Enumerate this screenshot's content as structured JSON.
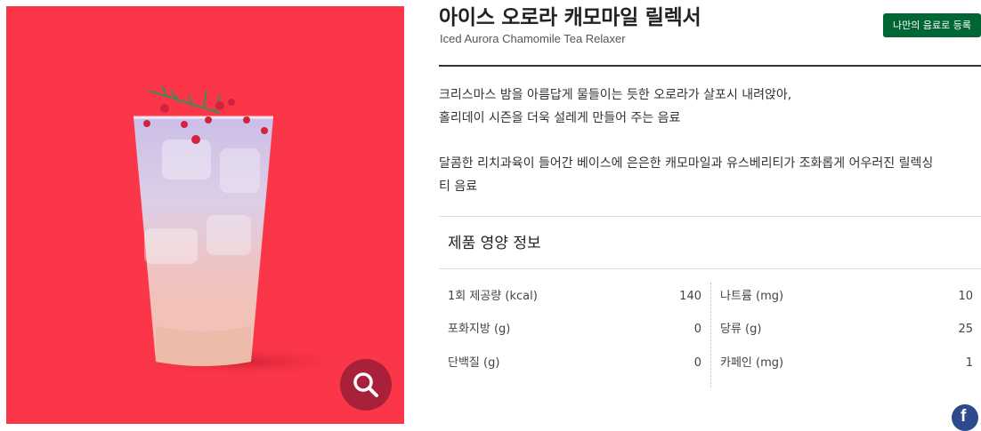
{
  "product": {
    "title_ko": "아이스 오로라 캐모마일 릴렉서",
    "title_en": "Iced Aurora Chamomile Tea Relaxer",
    "register_button": "나만의 음료로 등록",
    "description": [
      "크리스마스 밤을 아름답게 물들이는 듯한 오로라가 살포시 내려앉아,",
      "홀리데이 시즌을 더욱 설레게 만들어 주는 음료",
      "달콤한 리치과육이 들어간 베이스에 은은한 캐모마일과 유스베리티가 조화롭게 어우러진 릴렉싱",
      "티 음료"
    ]
  },
  "nutrition": {
    "title": "제품 영양 정보",
    "left": [
      {
        "label": "1회 제공량 (kcal)",
        "value": "140"
      },
      {
        "label": "포화지방 (g)",
        "value": "0"
      },
      {
        "label": "단백질 (g)",
        "value": "0"
      }
    ],
    "right": [
      {
        "label": "나트륨 (mg)",
        "value": "10"
      },
      {
        "label": "당류 (g)",
        "value": "25"
      },
      {
        "label": "카페인 (mg)",
        "value": "1"
      }
    ]
  },
  "icons": {
    "zoom": "magnifier-icon",
    "share": "facebook-icon",
    "facebook_glyph": "f"
  },
  "colors": {
    "hero_background": "#fb3649",
    "register_button": "#006633",
    "zoom_button": "#a8203a",
    "facebook": "#2c4a8c"
  }
}
